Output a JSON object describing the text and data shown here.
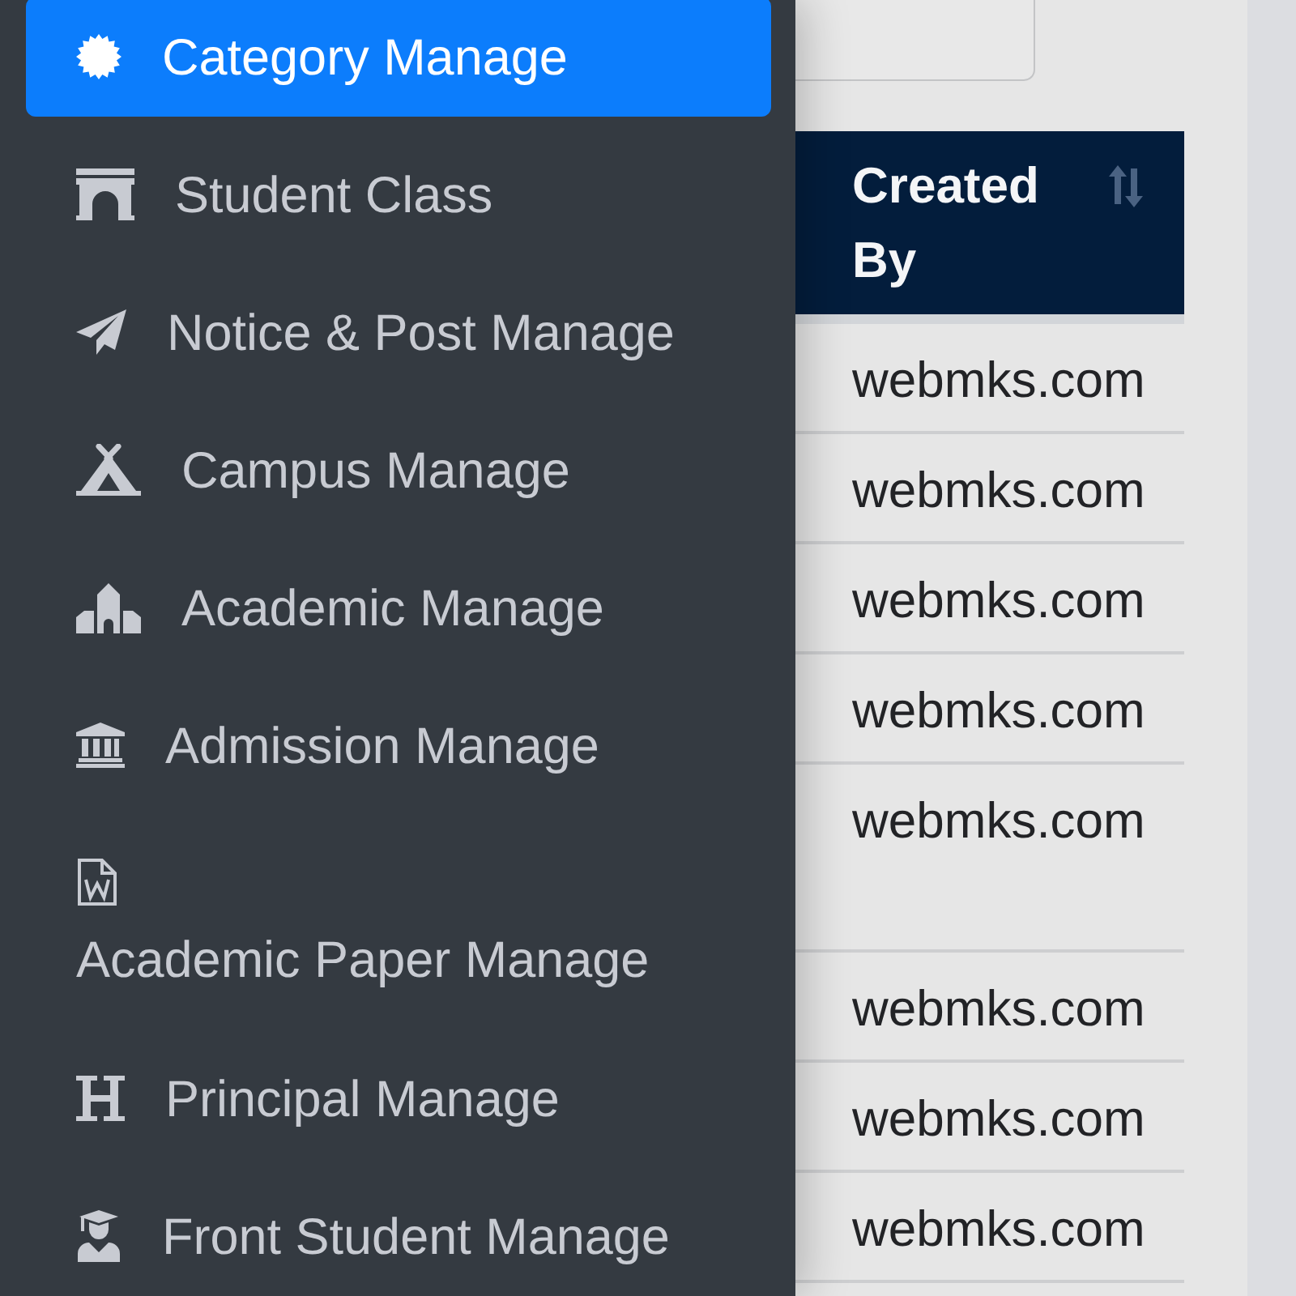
{
  "sidebar": {
    "items": [
      {
        "label": "Category Manage",
        "selected": true,
        "kind": "inline"
      },
      {
        "label": "Student Class",
        "selected": false,
        "kind": "inline"
      },
      {
        "label": "Notice & Post Manage",
        "selected": false,
        "kind": "inline"
      },
      {
        "label": "Campus Manage",
        "selected": false,
        "kind": "inline"
      },
      {
        "label": "Academic Manage",
        "selected": false,
        "kind": "inline"
      },
      {
        "label": "Admission Manage",
        "selected": false,
        "kind": "inline"
      },
      {
        "label": "Academic Paper Manage",
        "selected": false,
        "kind": "stacked"
      },
      {
        "label": "Principal Manage",
        "selected": false,
        "kind": "inline"
      },
      {
        "label": "Front Student Manage",
        "selected": false,
        "kind": "inline"
      }
    ]
  },
  "table": {
    "columns": [
      {
        "label": "Created By",
        "sortable": true
      }
    ],
    "rows": [
      {
        "created_by": "webmks.com"
      },
      {
        "created_by": "webmks.com"
      },
      {
        "created_by": "webmks.com"
      },
      {
        "created_by": "webmks.com"
      },
      {
        "created_by": "webmks.com"
      },
      {
        "created_by": "webmks.com"
      },
      {
        "created_by": "webmks.com"
      },
      {
        "created_by": "webmks.com"
      }
    ]
  }
}
